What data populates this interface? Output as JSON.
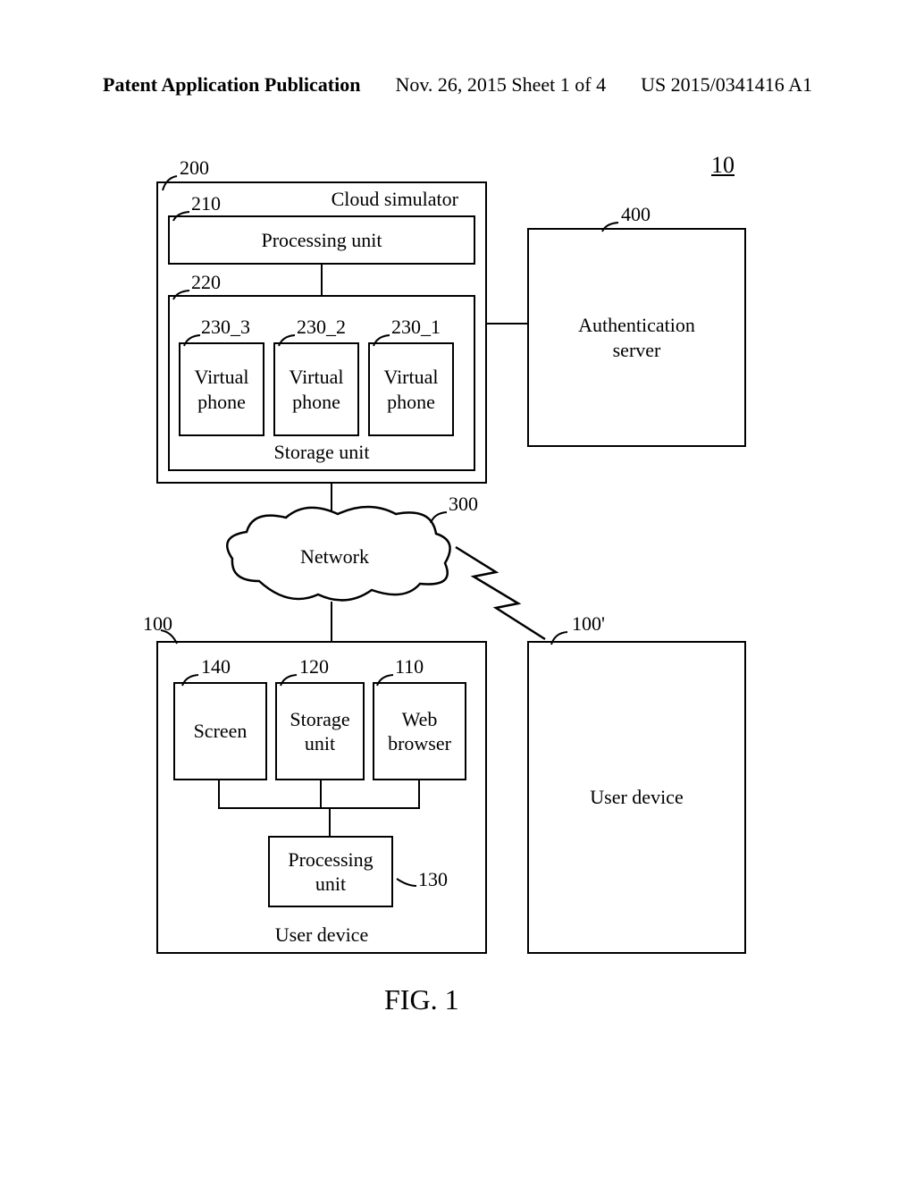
{
  "header": {
    "left": "Patent Application Publication",
    "center": "Nov. 26, 2015  Sheet 1 of 4",
    "right": "US 2015/0341416 A1"
  },
  "refs": {
    "system": "10",
    "cloud_sim": "200",
    "proc_unit_cloud": "210",
    "storage_cloud": "220",
    "vp1": "230_1",
    "vp2": "230_2",
    "vp3": "230_3",
    "auth": "400",
    "network": "300",
    "user1": "100",
    "user2": "100'",
    "web": "110",
    "storage_user": "120",
    "proc_user": "130",
    "screen": "140"
  },
  "blocks": {
    "cloud_sim_title": "Cloud simulator",
    "proc_unit": "Processing unit",
    "storage_unit": "Storage unit",
    "virtual_phone": "Virtual\nphone",
    "auth_server": "Authentication\nserver",
    "network": "Network",
    "screen": "Screen",
    "storage_small": "Storage\nunit",
    "web_browser": "Web\nbrowser",
    "proc_unit_small": "Processing\nunit",
    "user_device": "User device"
  },
  "caption": "FIG.  1"
}
